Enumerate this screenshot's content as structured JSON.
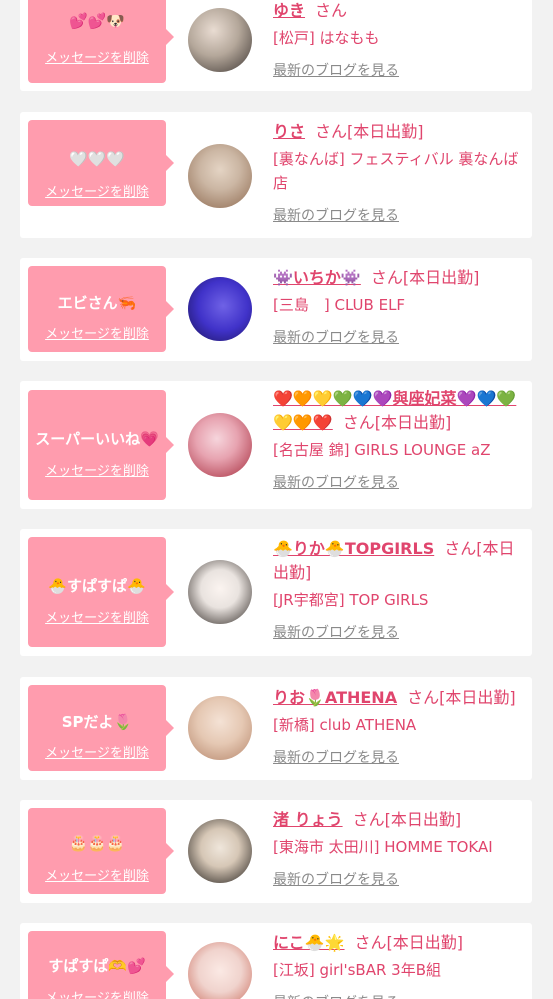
{
  "cards": [
    {
      "bubble_message": "💕💕🐶",
      "delete_label": "メッセージを削除",
      "name": "ゆき",
      "san": "さん",
      "shop": "[松戸] はなもも",
      "blog_link": "最新のブログを見る",
      "avatar_colors": [
        "#b4a79a",
        "#3b3431"
      ]
    },
    {
      "bubble_message": "🤍🤍🤍",
      "delete_label": "メッセージを削除",
      "name": "りさ",
      "san": "さん[本日出勤]",
      "shop": "[裏なんば] フェスティバル 裏なんば店",
      "blog_link": "最新のブログを見る",
      "avatar_colors": [
        "#cbb6a3",
        "#8e6a50"
      ]
    },
    {
      "bubble_message": "エビさん🦐",
      "delete_label": "メッセージを削除",
      "name": "👾いちか👾",
      "san": "さん[本日出勤]",
      "shop": "[三島　] CLUB ELF",
      "blog_link": "最新のブログを見る",
      "avatar_colors": [
        "#4032c9",
        "#1a1354"
      ]
    },
    {
      "bubble_message": "スーパーいいね💗",
      "delete_label": "メッセージを削除",
      "name": "❤️🧡💛💚💙💜與座妃菜💜💙💚💛🧡❤️",
      "san": "さん[本日出勤]",
      "shop": "[名古屋 錦] GIRLS LOUNGE aZ",
      "blog_link": "最新のブログを見る",
      "avatar_colors": [
        "#e7a3b0",
        "#a52b3c"
      ]
    },
    {
      "bubble_message": "🐣すぱすぱ🐣",
      "delete_label": "メッセージを削除",
      "name": "🐣りか🐣TOPGIRLS",
      "san": "さん[本日出勤]",
      "shop": "[JR宇都宮] TOP GIRLS",
      "blog_link": "最新のブログを見る",
      "avatar_colors": [
        "#e9e3df",
        "#2d2622"
      ]
    },
    {
      "bubble_message": "SPだよ🌷",
      "delete_label": "メッセージを削除",
      "name": "りお🌷ATHENA",
      "san": "さん[本日出勤]",
      "shop": "[新橋] club ATHENA",
      "blog_link": "最新のブログを見る",
      "avatar_colors": [
        "#e5c8b3",
        "#b5856a"
      ]
    },
    {
      "bubble_message": "🎂🎂🎂",
      "delete_label": "メッセージを削除",
      "name": "渚 りょう",
      "san": "さん[本日出勤]",
      "shop": "[東海市 太田川] HOMME TOKAI",
      "blog_link": "最新のブログを見る",
      "avatar_colors": [
        "#d6c7b6",
        "#1e1a17"
      ]
    },
    {
      "bubble_message": "すぱすぱ🫶💕",
      "delete_label": "メッセージを削除",
      "name": "にこ🐣🌟",
      "san": "さん[本日出勤]",
      "shop": "[江坂] girl'sBAR 3年B組",
      "blog_link": "最新のブログを見る",
      "avatar_colors": [
        "#f0d3cd",
        "#c96a5a"
      ]
    }
  ]
}
